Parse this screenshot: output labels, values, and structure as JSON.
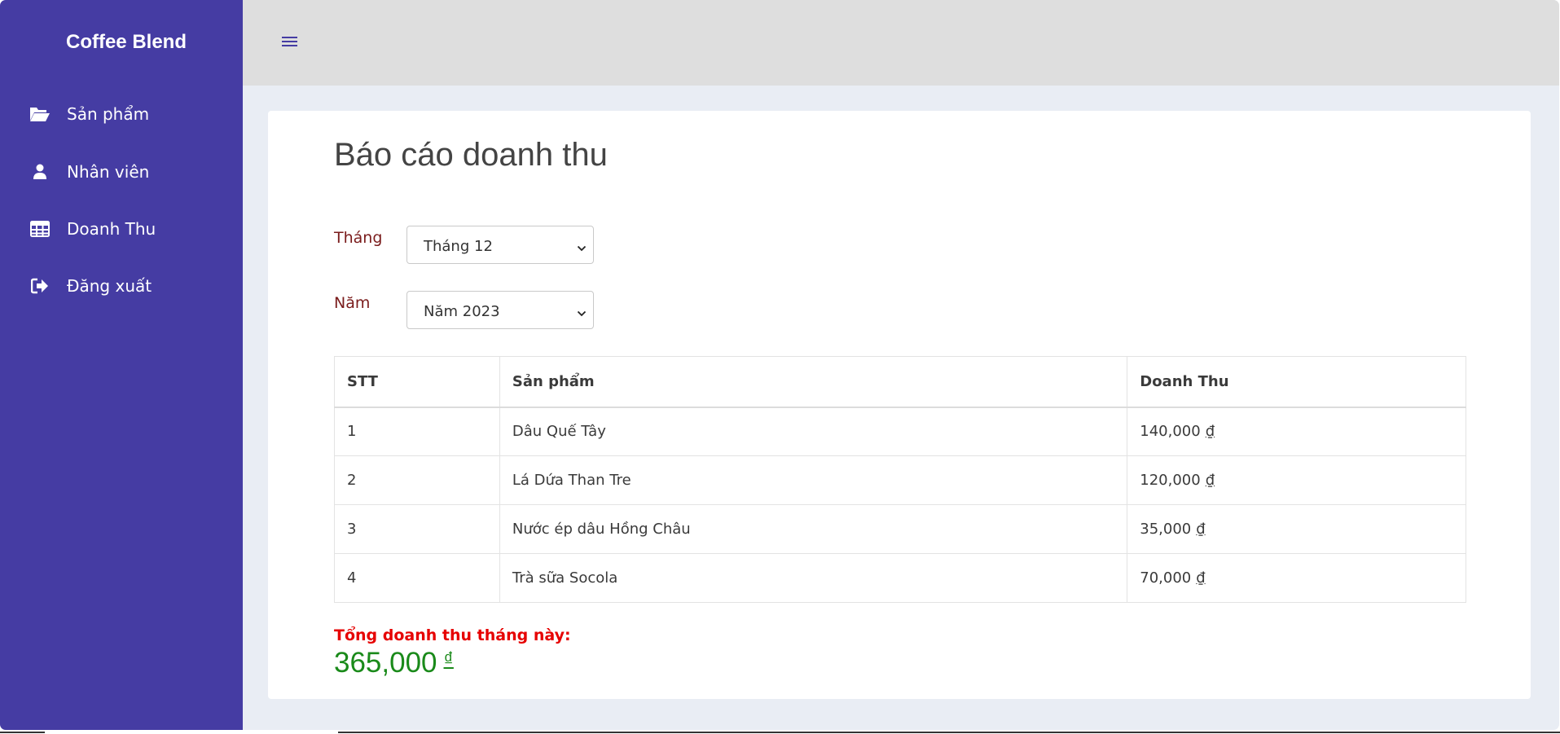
{
  "sidebar": {
    "brand": "Coffee Blend",
    "items": [
      {
        "label": "Sản phẩm",
        "icon": "folder-open-icon"
      },
      {
        "label": "Nhân viên",
        "icon": "user-icon"
      },
      {
        "label": "Doanh Thu",
        "icon": "table-icon"
      },
      {
        "label": "Đăng xuất",
        "icon": "logout-icon"
      }
    ]
  },
  "topbar": {
    "menu_icon": "hamburger-icon"
  },
  "main": {
    "title": "Báo cáo doanh thu",
    "filters": {
      "month_label": "Tháng",
      "month_value": "Tháng 12",
      "year_label": "Năm",
      "year_value": "Năm 2023"
    },
    "table": {
      "headers": [
        "STT",
        "Sản phẩm",
        "Doanh Thu"
      ],
      "rows": [
        {
          "stt": "1",
          "product": "Dâu Quế Tây",
          "revenue": "140,000",
          "currency": "₫"
        },
        {
          "stt": "2",
          "product": "Lá Dứa Than Tre",
          "revenue": "120,000",
          "currency": "₫"
        },
        {
          "stt": "3",
          "product": "Nước ép dâu Hồng Châu",
          "revenue": "35,000",
          "currency": "₫"
        },
        {
          "stt": "4",
          "product": "Trà sữa Socola",
          "revenue": "70,000",
          "currency": "₫"
        }
      ]
    },
    "total": {
      "label": "Tổng doanh thu tháng này:",
      "value": "365,000",
      "currency": "₫"
    }
  },
  "colors": {
    "sidebar_bg": "#453ca3",
    "topbar_bg": "#dedede",
    "page_bg": "#e9edf4",
    "label_color": "#7a1c1c",
    "total_label_color": "#e60000",
    "total_value_color": "#1a8a1a"
  }
}
